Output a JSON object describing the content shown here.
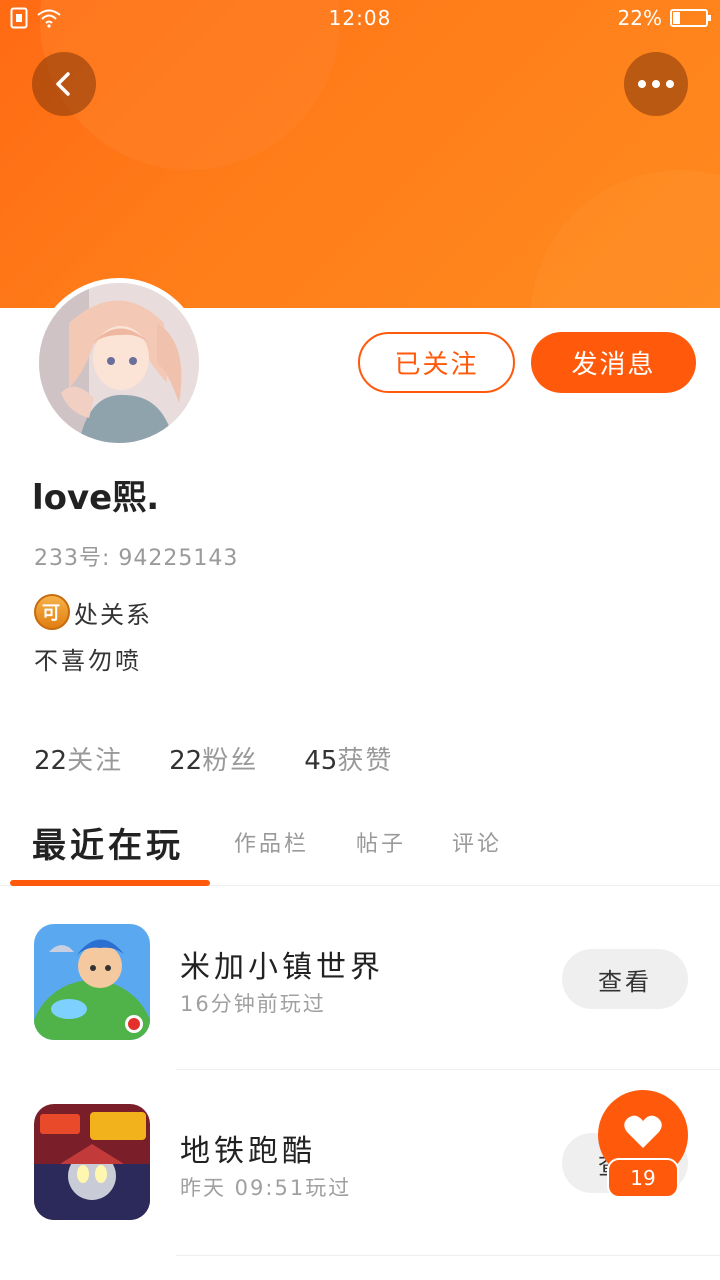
{
  "status_bar": {
    "time": "12:08",
    "battery": "22%",
    "battery_level": 0.22
  },
  "colors": {
    "accent": "#ff5a0c",
    "header": "#ff7a17"
  },
  "profile": {
    "name": "love熙.",
    "uid": "233号: 94225143",
    "tag_badge": "可",
    "tag_text": "处关系",
    "bio": "不喜勿喷",
    "follow_button": "已关注",
    "message_button": "发消息"
  },
  "stats": [
    {
      "num": "22",
      "label": "关注"
    },
    {
      "num": "22",
      "label": "粉丝"
    },
    {
      "num": "45",
      "label": "获赞"
    }
  ],
  "tabs": [
    "最近在玩",
    "作品栏",
    "帖子",
    "评论"
  ],
  "games": [
    {
      "name": "米加小镇世界",
      "time": "16分钟前玩过",
      "button": "查看"
    },
    {
      "name": "地铁跑酷",
      "time": "昨天 09:51玩过",
      "button": "查看"
    }
  ],
  "like": {
    "count": "19"
  },
  "icons": [
    "back-icon",
    "more-icon",
    "wifi-icon",
    "sim-icon",
    "heart-icon"
  ]
}
